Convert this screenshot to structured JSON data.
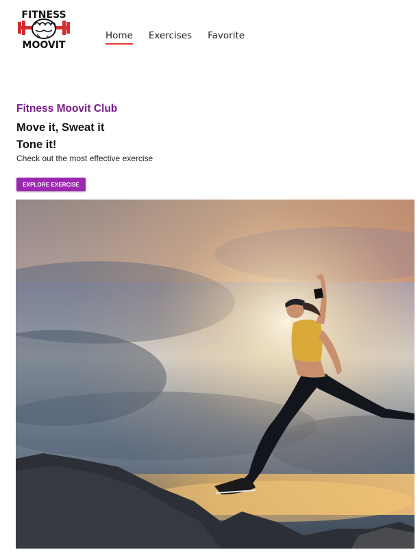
{
  "header": {
    "logo_text_top": "FITNESS",
    "logo_text_bottom": "MOOVIT",
    "nav": [
      {
        "label": "Home",
        "active": true
      },
      {
        "label": "Exercises",
        "active": false
      },
      {
        "label": "Favorite",
        "active": false
      }
    ]
  },
  "hero": {
    "club_title": "Fitness Moovit Club",
    "headline_line1": "Move it, Sweat it",
    "headline_line2": "Tone it!",
    "subtext": "Check out the most effective exercise",
    "cta_label": "EXPLORE EXERCISE",
    "image_icon": "woman-jumping-photo"
  },
  "colors": {
    "brand_purple": "#9c27b0",
    "title_purple": "#7a1a8c",
    "active_underline": "#e53935"
  }
}
